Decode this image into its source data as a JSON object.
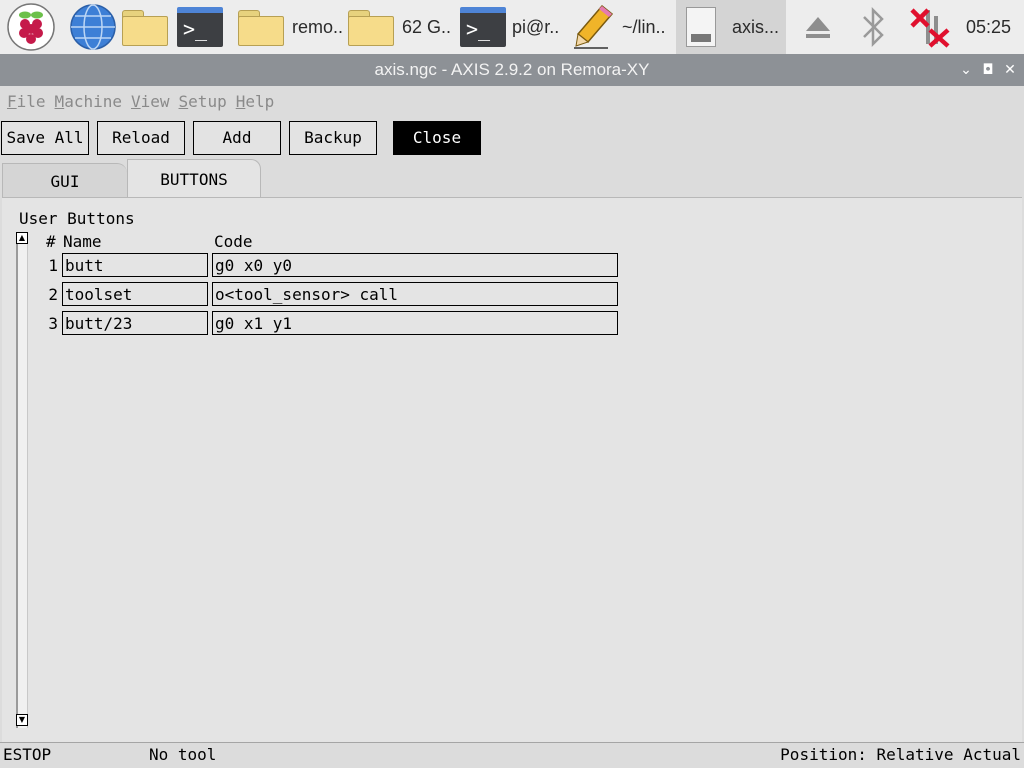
{
  "taskbar": {
    "items": [
      {
        "icon": "raspberry-menu-icon",
        "label": ""
      },
      {
        "icon": "web-browser-icon",
        "label": ""
      },
      {
        "icon": "file-manager-icon",
        "label": ""
      },
      {
        "icon": "terminal-icon",
        "label": ""
      },
      {
        "icon": "folder-icon",
        "label": "remo.."
      },
      {
        "icon": "folder-icon",
        "label": "62 G.."
      },
      {
        "icon": "terminal-icon",
        "label": "pi@r.."
      },
      {
        "icon": "pencil-icon",
        "label": "~/lin.."
      },
      {
        "icon": "document-icon",
        "label": "axis..."
      }
    ],
    "tray": {
      "eject_icon": "eject-icon",
      "bluetooth_icon": "bluetooth-icon",
      "network_icon": "network-disconnected-icon",
      "clock": "05:25"
    }
  },
  "window": {
    "title": "axis.ngc - AXIS 2.9.2 on Remora-XY",
    "minimize_glyph": "⌄",
    "maximize_glyph": "◘",
    "close_glyph": "✕"
  },
  "menu": [
    {
      "first": "F",
      "rest": "ile"
    },
    {
      "first": "M",
      "rest": "achine"
    },
    {
      "first": "V",
      "rest": "iew"
    },
    {
      "first": "S",
      "rest": "etup"
    },
    {
      "first": "H",
      "rest": "elp"
    }
  ],
  "toolbar": {
    "save_all": "Save All",
    "reload": "Reload",
    "add": "Add",
    "backup": "Backup",
    "close": "Close"
  },
  "tabs": {
    "gui": "GUI",
    "buttons": "BUTTONS"
  },
  "panel": {
    "title": "User Buttons",
    "col_num": "#",
    "col_name": "Name",
    "col_code": "Code",
    "rows": [
      {
        "num": "1",
        "name": "butt",
        "code": "g0 x0 y0"
      },
      {
        "num": "2",
        "name": "toolset",
        "code": "o<tool_sensor> call"
      },
      {
        "num": "3",
        "name": "butt/23",
        "code": "g0 x1 y1"
      }
    ],
    "scroll_up": "▲",
    "scroll_down": "▼"
  },
  "status": {
    "estop": "ESTOP",
    "tool": "No tool",
    "position": "Position: Relative Actual"
  }
}
